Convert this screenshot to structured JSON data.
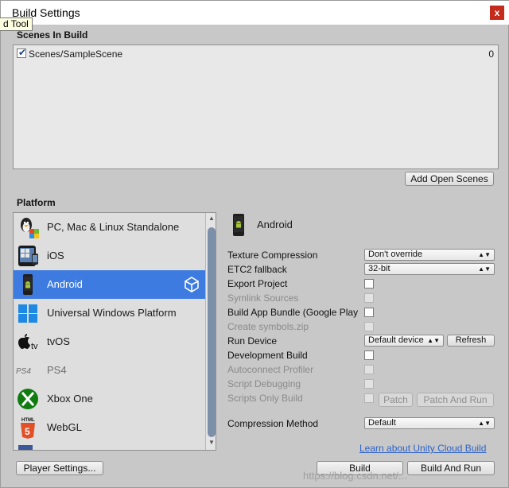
{
  "window": {
    "title": "Build Settings",
    "close_glyph": "x"
  },
  "tooltip": "d Tool",
  "scenes": {
    "label": "Scenes In Build",
    "items": [
      {
        "name": "Scenes/SampleScene",
        "index": "0",
        "checked": true
      }
    ],
    "add_open_scenes_label": "Add Open Scenes"
  },
  "platform": {
    "label": "Platform",
    "items": [
      {
        "label": "PC, Mac & Linux Standalone",
        "icon": "pc-mac-linux-icon"
      },
      {
        "label": "iOS",
        "icon": "ios-device-icon"
      },
      {
        "label": "Android",
        "icon": "android-device-icon",
        "selected": true,
        "active_icon": "unity-logo-icon"
      },
      {
        "label": "Universal Windows Platform",
        "icon": "windows-icon"
      },
      {
        "label": "tvOS",
        "icon": "apple-tv-icon"
      },
      {
        "label": "PS4",
        "icon": "ps4-icon",
        "dim": true
      },
      {
        "label": "Xbox One",
        "icon": "xbox-icon"
      },
      {
        "label": "WebGL",
        "icon": "html5-icon"
      }
    ]
  },
  "android_settings": {
    "title": "Android",
    "texture_compression": {
      "label": "Texture Compression",
      "value": "Don't override"
    },
    "etc2_fallback": {
      "label": "ETC2 fallback",
      "value": "32-bit"
    },
    "export_project": {
      "label": "Export Project"
    },
    "symlink_sources": {
      "label": "Symlink Sources"
    },
    "build_app_bundle": {
      "label": "Build App Bundle (Google Play"
    },
    "create_symbols": {
      "label": "Create symbols.zip"
    },
    "run_device": {
      "label": "Run Device",
      "value": "Default device",
      "refresh_label": "Refresh"
    },
    "development_build": {
      "label": "Development Build"
    },
    "autoconnect_profiler": {
      "label": "Autoconnect Profiler"
    },
    "script_debugging": {
      "label": "Script Debugging"
    },
    "scripts_only_build": {
      "label": "Scripts Only Build",
      "patch_label": "Patch",
      "patch_and_run_label": "Patch And Run"
    },
    "compression_method": {
      "label": "Compression Method",
      "value": "Default"
    },
    "cloud_build_link": "Learn about Unity Cloud Build"
  },
  "footer": {
    "player_settings_label": "Player Settings...",
    "build_label": "Build",
    "build_and_run_label": "Build And Run"
  },
  "watermark": "https://blog.csdn.net/..."
}
